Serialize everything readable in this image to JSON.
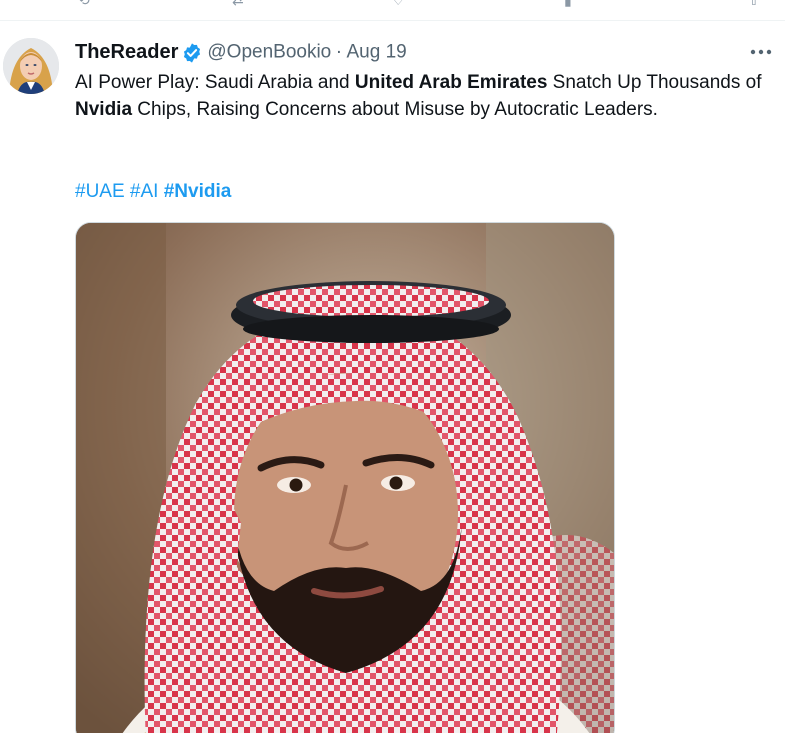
{
  "tweet": {
    "author": {
      "display_name": "TheReader",
      "handle": "@OpenBookio",
      "separator": "·",
      "date": "Aug 19",
      "verified": true
    },
    "text": {
      "seg1": "AI Power Play: Saudi Arabia and ",
      "seg2_bold": "United Arab Emirates",
      "seg3": " Snatch Up Thousands of ",
      "seg4_bold": "Nvidia",
      "seg5": " Chips, Raising Concerns about Misuse by Autocratic Leaders."
    },
    "hashtags": {
      "tag1": "#UAE",
      "tag2": "#AI",
      "tag3": "#Nvidia"
    },
    "more_icon": "more-horizontal-icon",
    "media": {
      "type": "photo"
    }
  },
  "colors": {
    "link": "#1d9bf0",
    "verified_badge": "#1d9bf0",
    "secondary_text": "#536471",
    "primary_text": "#0f1419"
  }
}
